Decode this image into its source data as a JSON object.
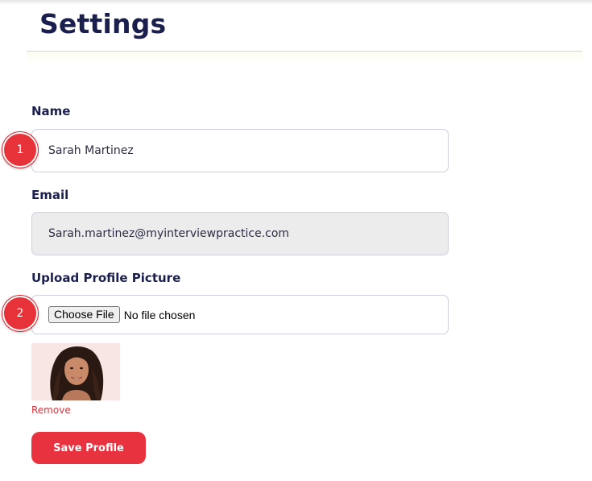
{
  "header": {
    "title": "Settings"
  },
  "form": {
    "name": {
      "label": "Name",
      "value": "Sarah Martinez"
    },
    "email": {
      "label": "Email",
      "value": "Sarah.martinez@myinterviewpractice.com"
    },
    "upload": {
      "label": "Upload Profile Picture",
      "button_label": "Choose File",
      "status": "No file chosen"
    },
    "photo": {
      "remove_label": "Remove"
    },
    "save_label": "Save Profile"
  },
  "markers": [
    {
      "label": "1"
    },
    {
      "label": "2"
    }
  ],
  "colors": {
    "accent": "#e8323f",
    "title": "#1a1f4e",
    "disabled_bg": "#ececec"
  }
}
